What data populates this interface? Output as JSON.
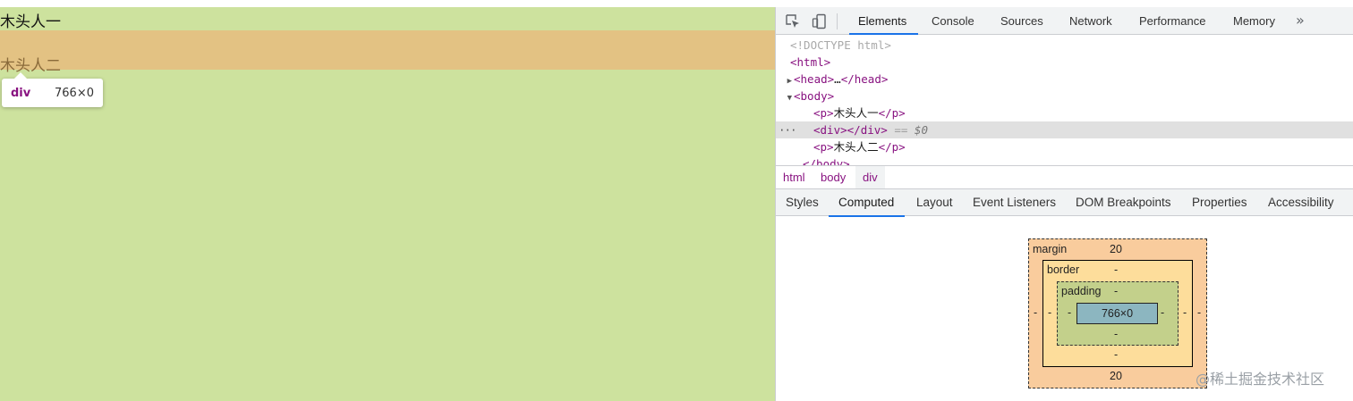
{
  "viewport": {
    "paragraph1": "木头人一",
    "paragraph2": "木头人二",
    "tooltip": {
      "tag": "div",
      "size": "766×0"
    },
    "colors": {
      "page_background": "#cde29e",
      "margin_highlight": "#e3c283"
    }
  },
  "devtools": {
    "toolbar": {
      "icons": [
        "inspect-element-icon",
        "device-toolbar-icon"
      ],
      "tabs": [
        "Elements",
        "Console",
        "Sources",
        "Network",
        "Performance",
        "Memory"
      ],
      "active_tab": "Elements",
      "more": "»"
    },
    "dom": {
      "doctype": "<!DOCTYPE html>",
      "html_open": "<html>",
      "head": {
        "open": "<head>",
        "ellipsis": "…",
        "close": "</head>"
      },
      "body_open": "<body>",
      "p1": {
        "open": "<p>",
        "text": "木头人一",
        "close": "</p>"
      },
      "div": {
        "open": "<div>",
        "close": "</div>",
        "eq": "==",
        "ref": "$0",
        "dots": "···"
      },
      "p2": {
        "open": "<p>",
        "text": "木头人二",
        "close": "</p>"
      },
      "body_close_partial": "</body>"
    },
    "breadcrumbs": [
      "html",
      "body",
      "div"
    ],
    "sub_tabs": [
      "Styles",
      "Computed",
      "Layout",
      "Event Listeners",
      "DOM Breakpoints",
      "Properties",
      "Accessibility"
    ],
    "active_sub_tab": "Computed",
    "box_model": {
      "margin_label": "margin",
      "margin_top": "20",
      "margin_bottom": "20",
      "margin_left": "-",
      "margin_right": "-",
      "border_label": "border",
      "border_top": "-",
      "border_bottom": "-",
      "border_left": "-",
      "border_right": "-",
      "padding_label": "padding",
      "padding_top": "-",
      "padding_bottom": "-",
      "padding_left": "-",
      "padding_right": "-",
      "content": "766×0",
      "colors": {
        "margin": "#f9cc9d",
        "border": "#fddd9b",
        "padding": "#c3d08b",
        "content": "#8cb6c0"
      }
    },
    "accent_color": "#1a73e8"
  },
  "watermark": "@稀土掘金技术社区"
}
